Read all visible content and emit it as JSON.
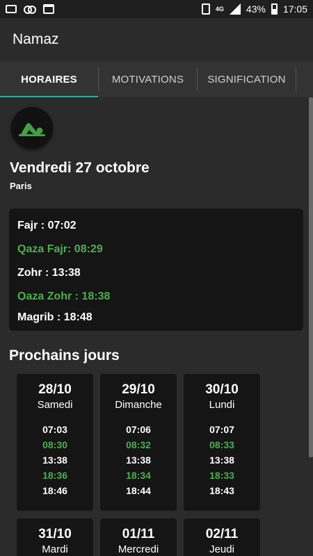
{
  "status_bar": {
    "left_icons": [
      "image-icon",
      "voicemail-icon",
      "calendar-icon"
    ],
    "network": "4G",
    "battery": "43%",
    "time": "17:05"
  },
  "app": {
    "title": "Namaz"
  },
  "tabs": [
    {
      "label": "HORAIRES",
      "active": true
    },
    {
      "label": "MOTIVATIONS",
      "active": false
    },
    {
      "label": "SIGNIFICATION",
      "active": false
    }
  ],
  "today": {
    "date": "Vendredi 27 octobre",
    "city": "Paris",
    "prayers": [
      {
        "text": "Fajr : 07:02",
        "qaza": false
      },
      {
        "text": "Qaza Fajr: 08:29",
        "qaza": true
      },
      {
        "text": "Zohr : 13:38",
        "qaza": false
      },
      {
        "text": "Qaza Zohr : 18:38",
        "qaza": true
      }
    ],
    "last_prayer": "Magrib : 18:48"
  },
  "next_days": {
    "title": "Prochains jours",
    "days": [
      {
        "date": "28/10",
        "name": "Samedi",
        "times": [
          "07:03",
          "08:30",
          "13:38",
          "18:36",
          "18:46"
        ]
      },
      {
        "date": "29/10",
        "name": "Dimanche",
        "times": [
          "07:06",
          "08:32",
          "13:38",
          "18:34",
          "18:44"
        ]
      },
      {
        "date": "30/10",
        "name": "Lundi",
        "times": [
          "07:07",
          "08:33",
          "13:38",
          "18:33",
          "18:43"
        ]
      },
      {
        "date": "31/10",
        "name": "Mardi",
        "times": []
      },
      {
        "date": "01/11",
        "name": "Mercredi",
        "times": []
      },
      {
        "date": "02/11",
        "name": "Jeudi",
        "times": []
      }
    ]
  },
  "colors": {
    "accent": "#3fa69a",
    "qaza": "#4caf50",
    "card": "#151515",
    "background": "#2b2b2b"
  }
}
